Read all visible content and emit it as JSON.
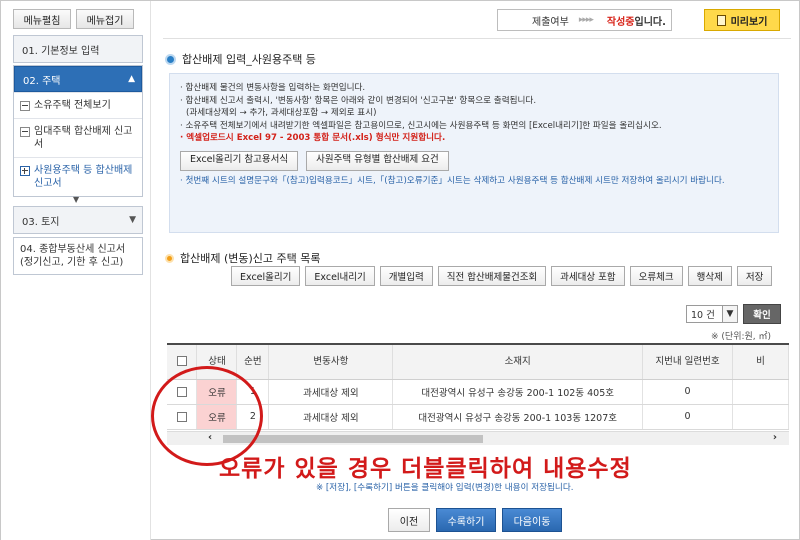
{
  "sidebar": {
    "buttons": [
      "메뉴펼침",
      "메뉴접기"
    ],
    "menu1": {
      "label": "01. 기본정보 입력"
    },
    "menu2": {
      "label": "02. 주택",
      "items": [
        {
          "label": "소유주택 전체보기",
          "icon": "minus-box-icon"
        },
        {
          "label": "임대주택 합산배제 신고서",
          "icon": "minus-box-icon"
        },
        {
          "label": "사원용주택 등 합산배제 신고서",
          "icon": "plus-box-icon"
        }
      ]
    },
    "menu3": {
      "label": "03. 토지"
    },
    "menu4": {
      "label": "04. 종합부동산세 신고서(정기신고, 기한 후 신고)"
    }
  },
  "header": {
    "status_label": "제출여부",
    "status_arrows": "▸▸▸▸",
    "status_value": "작성중",
    "status_suffix": "입니다.",
    "preview_label": "미리보기"
  },
  "section1": {
    "title": "합산배제 입력_사원용주택 등",
    "lines": [
      "합산배제 물건의 변동사항을 입력하는 화면입니다.",
      "합산배제 신고서 출력시, '변동사항' 항목은 아래와 같이 변경되어 '신고구분' 항목으로 출력됩니다.",
      "(과세대상제외 → 추가, 과세대상포함 → 제외로 표시)",
      "소유주택 전체보기에서 내려받기한 엑셀파일은 참고용이므로, 신고시에는 사원용주택 등 화면의 [Excel내리기]한 파일을 올리십시오.",
      "엑셀업로드시 Excel 97 - 2003 통합 문서(.xls) 형식만 지원합니다."
    ],
    "buttons": [
      "Excel올리기 참고용서식",
      "사원주택 유형별 합산배제 요건"
    ],
    "note": "첫번째 시트의 설명문구와「(참고)입력용코드」시트,「(참고)오류기준」시트는 삭제하고 사원용주택 등 합산배제 시트만 저장하여 올리시기 바랍니다."
  },
  "section2": {
    "title": "합산배제 (변동)신고 주택 목록",
    "toolbar": [
      "Excel올리기",
      "Excel내리기",
      "개별입력",
      "직전 합산배제물건조회",
      "과세대상 포함",
      "오류체크",
      "행삭제",
      "저장"
    ],
    "page_size": "10 건",
    "confirm_label": "확인",
    "unit_note": "※ (단위:원, ㎡)",
    "columns": [
      "",
      "상태",
      "순번",
      "변동사항",
      "소재지",
      "지번내 일련번호",
      "비"
    ],
    "rows": [
      {
        "status": "오류",
        "seq": "1",
        "change": "과세대상 제외",
        "address": "대전광역시 유성구 송강동 200-1 102동 405호",
        "serial": "0"
      },
      {
        "status": "오류",
        "seq": "2",
        "change": "과세대상 제외",
        "address": "대전광역시 유성구 송강동 200-1 103동 1207호",
        "serial": "0"
      }
    ]
  },
  "annotation": {
    "text": "오류가 있을 경우 더블클릭하여 내용수정",
    "color": "#d21a1a"
  },
  "save_note": "※ [저장], [수록하기] 버튼을 클릭해야 입력(변경)한 내용이 저장됩니다.",
  "bottom_buttons": [
    "이전",
    "수록하기",
    "다음이동"
  ],
  "colors": {
    "accent_blue": "#2d6fb6",
    "error_bg": "#fbd2d2",
    "preview_yellow": "#ffd94a",
    "alert_red": "#d3221a"
  }
}
